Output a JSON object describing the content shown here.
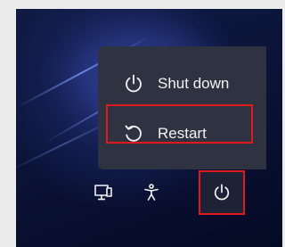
{
  "power_menu": {
    "items": [
      {
        "label": "Shut down",
        "icon": "power-icon"
      },
      {
        "label": "Restart",
        "icon": "restart-icon"
      }
    ],
    "highlighted_item": "Restart"
  },
  "taskbar": {
    "icons": [
      "network-icon",
      "accessibility-icon",
      "power-icon"
    ]
  },
  "colors": {
    "highlight_border": "#e01a1a",
    "menu_background": "#2e3241",
    "wallpaper": "#0a1236",
    "text": "#f3f3f3"
  }
}
